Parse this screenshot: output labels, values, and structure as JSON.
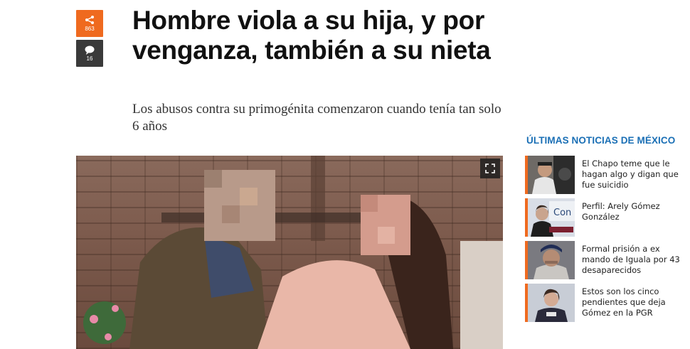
{
  "share": {
    "count": "863"
  },
  "comments": {
    "count": "16"
  },
  "article": {
    "title": "Hombre viola a su hija, y por venganza, también a su nieta",
    "subtitle": "Los abusos contra su primogénita comenzaron cuando tenía tan solo 6 años"
  },
  "sidebar": {
    "heading": "ÚLTIMAS NOTICIAS DE MÉXICO",
    "items": [
      {
        "title": "El Chapo teme que le hagan algo y digan que fue suicidio"
      },
      {
        "title": "Perfil: Arely Gómez González",
        "thumb_text": "Con"
      },
      {
        "title": "Formal prisión a ex mando de Iguala por 43 desaparecidos"
      },
      {
        "title": "Estos son los cinco pendientes que deja Gómez en la PGR"
      }
    ]
  },
  "colors": {
    "accent": "#ef6a1f",
    "link": "#1a6fb5"
  }
}
